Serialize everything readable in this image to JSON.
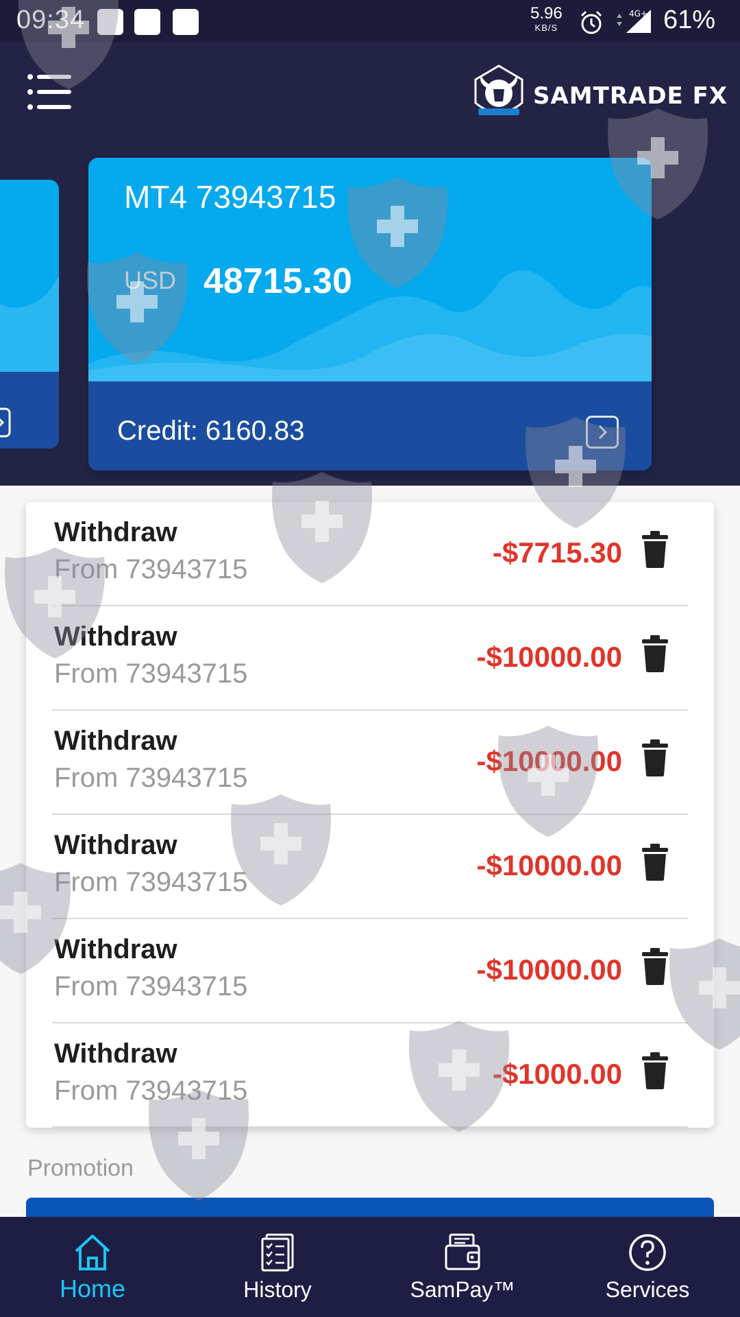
{
  "status_bar": {
    "time": "09:34",
    "net_speed_value": "5.96",
    "net_speed_unit": "KB/S",
    "network": "4G+",
    "battery": "61%"
  },
  "header": {
    "brand": "SAMTRADE FX",
    "menu_icon": "hamburger-menu-icon",
    "logo_icon": "samtrade-bull-logo"
  },
  "account": {
    "title": "MT4 73943715",
    "currency": "USD",
    "balance": "48715.30",
    "credit": "Credit: 6160.83",
    "open_icon": "chevron-right-square-icon"
  },
  "transactions": [
    {
      "label": "Withdraw",
      "sub": "From 73943715",
      "amount": "-$7715.30"
    },
    {
      "label": "Withdraw",
      "sub": "From 73943715",
      "amount": "-$10000.00"
    },
    {
      "label": "Withdraw",
      "sub": "From 73943715",
      "amount": "-$10000.00"
    },
    {
      "label": "Withdraw",
      "sub": "From 73943715",
      "amount": "-$10000.00"
    },
    {
      "label": "Withdraw",
      "sub": "From 73943715",
      "amount": "-$10000.00"
    },
    {
      "label": "Withdraw",
      "sub": "From 73943715",
      "amount": "-$1000.00"
    }
  ],
  "promotion": {
    "label": "Promotion"
  },
  "nav": [
    {
      "label": "Home",
      "icon": "home-icon",
      "active": true
    },
    {
      "label": "History",
      "icon": "history-checklist-icon",
      "active": false
    },
    {
      "label": "SamPay™",
      "icon": "wallet-icon",
      "active": false
    },
    {
      "label": "Services",
      "icon": "help-circle-icon",
      "active": false
    }
  ],
  "colors": {
    "header_bg": "#232346",
    "card_blue": "#04a9ee",
    "card_footer": "#1a4d9f",
    "amount_red": "#e0352b",
    "nav_active": "#1cc6f5",
    "nav_bg": "#1e1e44"
  }
}
